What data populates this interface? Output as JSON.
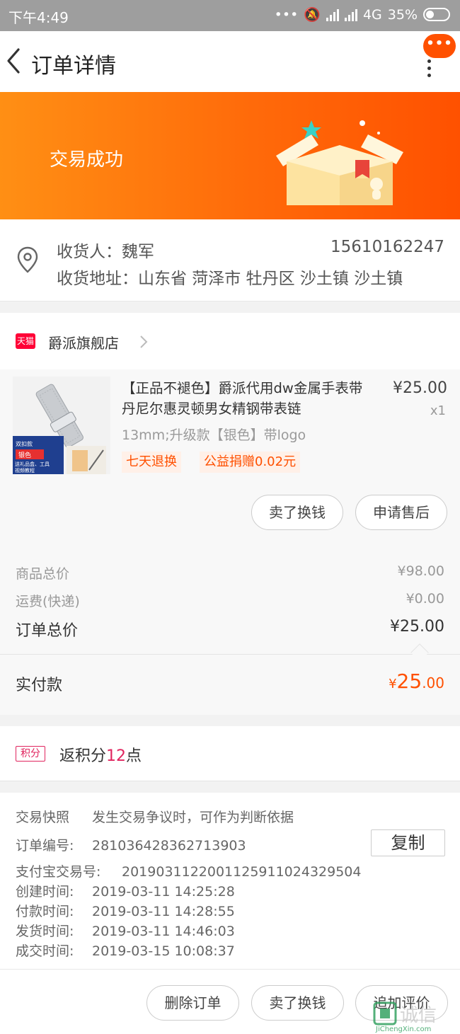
{
  "status_bar": {
    "time": "下午4:49",
    "network": "4G",
    "battery": "35%"
  },
  "nav": {
    "title": "订单详情",
    "more_label": "•••"
  },
  "banner": {
    "status": "交易成功"
  },
  "address": {
    "receiver": "收货人：魏军",
    "phone": "15610162247",
    "address_line": "收货地址：山东省 菏泽市 牡丹区 沙土镇 沙土镇"
  },
  "shop": {
    "badge": "天猫",
    "name": "爵派旗舰店"
  },
  "product": {
    "title": "【正品不褪色】爵派代用dw金属手表带丹尼尔惠灵顿男女精钢带表链",
    "price": "¥25.00",
    "quantity": "x1",
    "sku": "13mm;升级款【银色】带logo",
    "tags": [
      "七天退换",
      "公益捐赠0.02元"
    ],
    "thumb_text": [
      "双扣款",
      "银色",
      "送礼品盒、工具",
      "视频教程"
    ],
    "buttons": [
      "卖了换钱",
      "申请售后"
    ]
  },
  "summary": {
    "goods_label": "商品总价",
    "goods_value": "¥98.00",
    "shipping_label": "运费(快递)",
    "shipping_value": "¥0.00",
    "total_label": "订单总价",
    "total_value": "¥25.00",
    "paid_label": "实付款",
    "paid_currency": "¥",
    "paid_int": "25",
    "paid_dec": ".00"
  },
  "points": {
    "badge": "积分",
    "prefix": "返积分",
    "amount": "12",
    "suffix": "点"
  },
  "order_info": {
    "snapshot_label": "交易快照",
    "snapshot_desc": "发生交易争议时，可作为判断依据",
    "order_no_label": "订单编号:",
    "order_no": "281036428362713903",
    "copy_label": "复制",
    "alipay_label": "支付宝交易号:",
    "alipay_no": "2019031122001125911024329504",
    "created_label": "创建时间:",
    "created": "2019-03-11 14:25:28",
    "paid_label": "付款时间:",
    "paid": "2019-03-11 14:28:55",
    "shipped_label": "发货时间:",
    "shipped": "2019-03-11 14:46:03",
    "done_label": "成交时间:",
    "done": "2019-03-15 10:08:37"
  },
  "actions": [
    "删除订单",
    "卖了换钱",
    "追加评价"
  ],
  "watermark": {
    "text": "诚信",
    "sub": "JiChengXin.com"
  },
  "colors": {
    "accent": "#ff5000",
    "banner_start": "#ff8f14",
    "banner_end": "#ff5100",
    "points": "#e0245e"
  }
}
